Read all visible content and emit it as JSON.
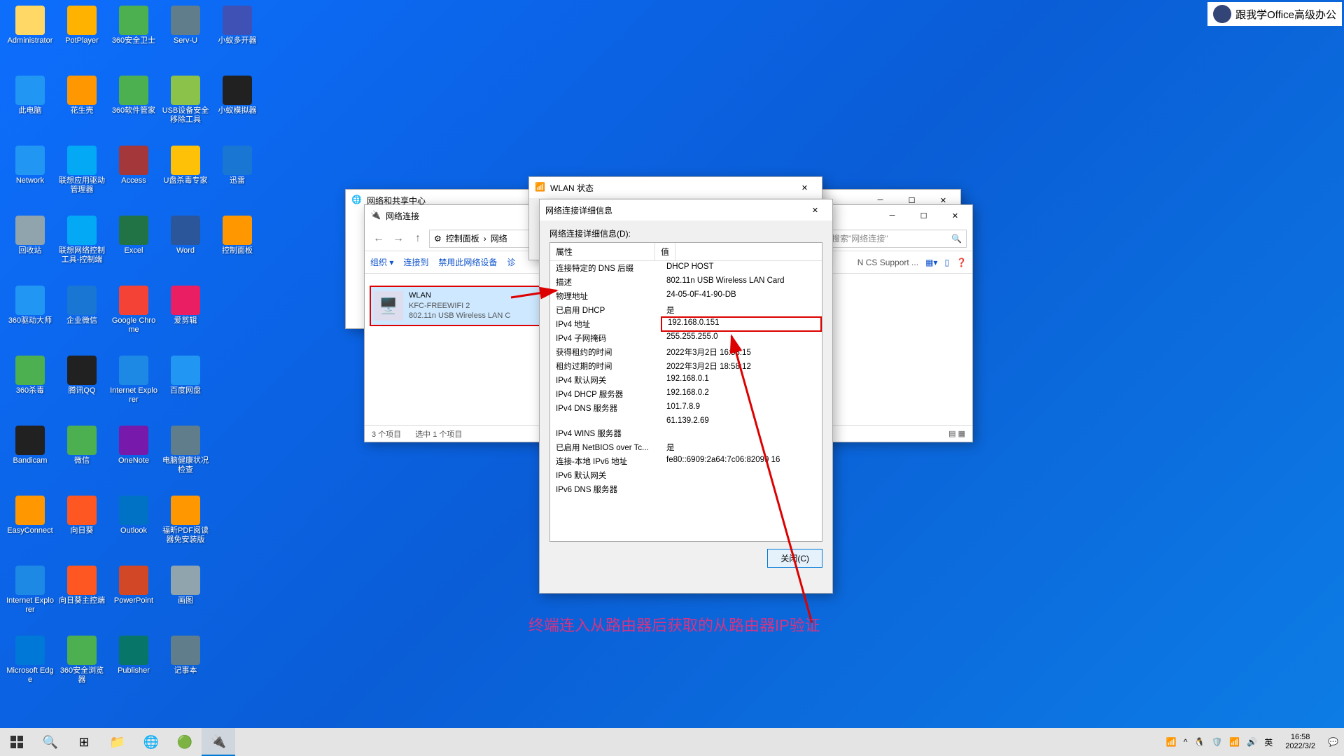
{
  "desktop_icons": [
    {
      "row": 0,
      "col": 0,
      "label": "Administrator",
      "color": "#ffd866"
    },
    {
      "row": 0,
      "col": 1,
      "label": "PotPlayer",
      "color": "#ffb300"
    },
    {
      "row": 0,
      "col": 2,
      "label": "360安全卫士",
      "color": "#4caf50"
    },
    {
      "row": 0,
      "col": 3,
      "label": "Serv-U",
      "color": "#607d8b"
    },
    {
      "row": 0,
      "col": 4,
      "label": "小蚁多开器",
      "color": "#3f51b5"
    },
    {
      "row": 1,
      "col": 0,
      "label": "此电脑",
      "color": "#2196f3"
    },
    {
      "row": 1,
      "col": 1,
      "label": "花生壳",
      "color": "#ff9800"
    },
    {
      "row": 1,
      "col": 2,
      "label": "360软件管家",
      "color": "#4caf50"
    },
    {
      "row": 1,
      "col": 3,
      "label": "USB设备安全移除工具",
      "color": "#8bc34a"
    },
    {
      "row": 1,
      "col": 4,
      "label": "小蚁模拟器",
      "color": "#212121"
    },
    {
      "row": 2,
      "col": 0,
      "label": "Network",
      "color": "#2196f3"
    },
    {
      "row": 2,
      "col": 1,
      "label": "联想应用驱动管理器",
      "color": "#03a9f4"
    },
    {
      "row": 2,
      "col": 2,
      "label": "Access",
      "color": "#a4373a"
    },
    {
      "row": 2,
      "col": 3,
      "label": "U盘杀毒专家",
      "color": "#ffc107"
    },
    {
      "row": 2,
      "col": 4,
      "label": "迅雷",
      "color": "#1976d2"
    },
    {
      "row": 3,
      "col": 0,
      "label": "回收站",
      "color": "#90a4ae"
    },
    {
      "row": 3,
      "col": 1,
      "label": "联想网络控制工具-控制端",
      "color": "#03a9f4"
    },
    {
      "row": 3,
      "col": 2,
      "label": "Excel",
      "color": "#217346"
    },
    {
      "row": 3,
      "col": 3,
      "label": "Word",
      "color": "#2b579a"
    },
    {
      "row": 3,
      "col": 4,
      "label": "控制面板",
      "color": "#ff9800"
    },
    {
      "row": 4,
      "col": 0,
      "label": "360驱动大师",
      "color": "#2196f3"
    },
    {
      "row": 4,
      "col": 1,
      "label": "企业微信",
      "color": "#1976d2"
    },
    {
      "row": 4,
      "col": 2,
      "label": "Google Chrome",
      "color": "#f44336"
    },
    {
      "row": 4,
      "col": 3,
      "label": "爱剪辑",
      "color": "#e91e63"
    },
    {
      "row": 5,
      "col": 0,
      "label": "360杀毒",
      "color": "#4caf50"
    },
    {
      "row": 5,
      "col": 1,
      "label": "腾讯QQ",
      "color": "#212121"
    },
    {
      "row": 5,
      "col": 2,
      "label": "Internet Explorer",
      "color": "#1e88e5"
    },
    {
      "row": 5,
      "col": 3,
      "label": "百度网盘",
      "color": "#2196f3"
    },
    {
      "row": 6,
      "col": 0,
      "label": "Bandicam",
      "color": "#212121"
    },
    {
      "row": 6,
      "col": 1,
      "label": "微信",
      "color": "#4caf50"
    },
    {
      "row": 6,
      "col": 2,
      "label": "OneNote",
      "color": "#7719aa"
    },
    {
      "row": 6,
      "col": 3,
      "label": "电脑健康状况检查",
      "color": "#607d8b"
    },
    {
      "row": 7,
      "col": 0,
      "label": "EasyConnect",
      "color": "#ff9800"
    },
    {
      "row": 7,
      "col": 1,
      "label": "向日葵",
      "color": "#ff5722"
    },
    {
      "row": 7,
      "col": 2,
      "label": "Outlook",
      "color": "#0072c6"
    },
    {
      "row": 7,
      "col": 3,
      "label": "福昕PDF阅读器免安装版",
      "color": "#ff9800"
    },
    {
      "row": 8,
      "col": 0,
      "label": "Internet Explorer",
      "color": "#1e88e5"
    },
    {
      "row": 8,
      "col": 1,
      "label": "向日葵主控端",
      "color": "#ff5722"
    },
    {
      "row": 8,
      "col": 2,
      "label": "PowerPoint",
      "color": "#d24726"
    },
    {
      "row": 8,
      "col": 3,
      "label": "画图",
      "color": "#90a4ae"
    },
    {
      "row": 9,
      "col": 0,
      "label": "Microsoft Edge",
      "color": "#0078d7"
    },
    {
      "row": 9,
      "col": 1,
      "label": "360安全浏览器",
      "color": "#4caf50"
    },
    {
      "row": 9,
      "col": 2,
      "label": "Publisher",
      "color": "#077568"
    },
    {
      "row": 9,
      "col": 3,
      "label": "记事本",
      "color": "#607d8b"
    }
  ],
  "netshare": {
    "title": "网络和共享中心"
  },
  "netconn": {
    "title": "网络连接",
    "crumb_prefix": "控制面板",
    "crumb_item": "网络",
    "search_placeholder": "搜索\"网络连接\"",
    "cmd": {
      "org": "组织 ▾",
      "conn": "连接到",
      "disable": "禁用此网络设备",
      "diag": "诊",
      "right_text": "N CS Support ..."
    },
    "item": {
      "name": "WLAN",
      "ssid": "KFC-FREEWIFI 2",
      "desc": "802.11n USB Wireless LAN C"
    },
    "status": {
      "count": "3 个项目",
      "sel": "选中 1 个项目"
    }
  },
  "wlanstatus": {
    "title": "WLAN 状态"
  },
  "detail": {
    "title": "网络连接详细信息",
    "label": "网络连接详细信息(D):",
    "col_prop": "属性",
    "col_val": "值",
    "rows": [
      {
        "k": "连接特定的 DNS 后缀",
        "v": "DHCP HOST"
      },
      {
        "k": "描述",
        "v": "802.11n USB Wireless LAN Card"
      },
      {
        "k": "物理地址",
        "v": "24-05-0F-41-90-DB"
      },
      {
        "k": "已启用 DHCP",
        "v": "是"
      },
      {
        "k": "IPv4 地址",
        "v": "192.168.0.151",
        "hl": true
      },
      {
        "k": "IPv4 子网掩码",
        "v": "255.255.255.0"
      },
      {
        "k": "获得租约的时间",
        "v": "2022年3月2日 16:58:15"
      },
      {
        "k": "租约过期的时间",
        "v": "2022年3月2日 18:58:12"
      },
      {
        "k": "IPv4 默认网关",
        "v": "192.168.0.1"
      },
      {
        "k": "IPv4 DHCP 服务器",
        "v": "192.168.0.2"
      },
      {
        "k": "IPv4 DNS 服务器",
        "v": "101.7.8.9"
      },
      {
        "k": "",
        "v": "61.139.2.69"
      },
      {
        "k": "IPv4 WINS 服务器",
        "v": ""
      },
      {
        "k": "已启用 NetBIOS over Tc...",
        "v": "是"
      },
      {
        "k": "连接-本地 IPv6 地址",
        "v": "fe80::6909:2a64:7c06:82099 16"
      },
      {
        "k": "IPv6 默认网关",
        "v": ""
      },
      {
        "k": "IPv6 DNS 服务器",
        "v": ""
      }
    ],
    "close_btn": "关闭(C)"
  },
  "annotation": "终端连入从路由器后获取的从路由器IP验证",
  "watermark": "跟我学Office高级办公",
  "taskbar": {
    "tray": {
      "ime": "英",
      "time": "16:58",
      "date": "2022/3/2"
    }
  }
}
